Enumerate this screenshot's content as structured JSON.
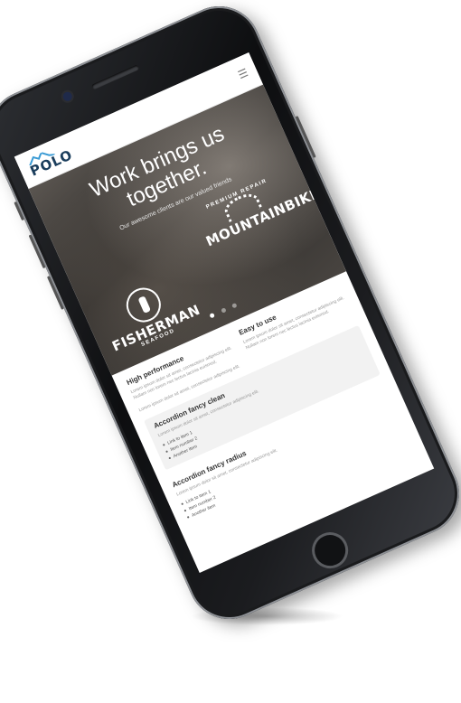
{
  "brand": {
    "name": "POLO"
  },
  "hero": {
    "title_line1": "Work brings us",
    "title_line2": "together.",
    "subtitle": "Our awesome clients are our valued friends",
    "badge_mtb_top": "PREMIUM REPAIR",
    "badge_mtb_main": "MOUNTAINBIKE",
    "badge_fish_main": "FISHERMAN",
    "badge_fish_bottom": "SEAFOOD"
  },
  "features": [
    {
      "title": "High performance",
      "text": "Lorem ipsum dolor sit amet, consectetur adipiscing elit. Nullam non lorem nec lectus lacinia euismod."
    },
    {
      "title": "Easy to use",
      "text": "Lorem ipsum dolor sit amet, consectetur adipiscing elit. Nullam non lorem nec lectus lacinia euismod."
    }
  ],
  "intro_text": "Lorem ipsum dolor sit amet, consectetur adipiscing elit.",
  "accordion_clean": {
    "title": "Accordion fancy clean",
    "text": "Lorem ipsum dolor sit amet, consectetur adipiscing elit.",
    "items": [
      "Link to item 1",
      "Item number 2",
      "Another item"
    ]
  },
  "accordion_radius": {
    "title": "Accordion fancy radius",
    "text": "Lorem ipsum dolor sit amet, consectetur adipiscing elit.",
    "items": [
      "Link to item 1",
      "Item number 2",
      "Another item"
    ]
  },
  "colors": {
    "brand": "#1a3d5c",
    "phone_body": "#111214"
  }
}
